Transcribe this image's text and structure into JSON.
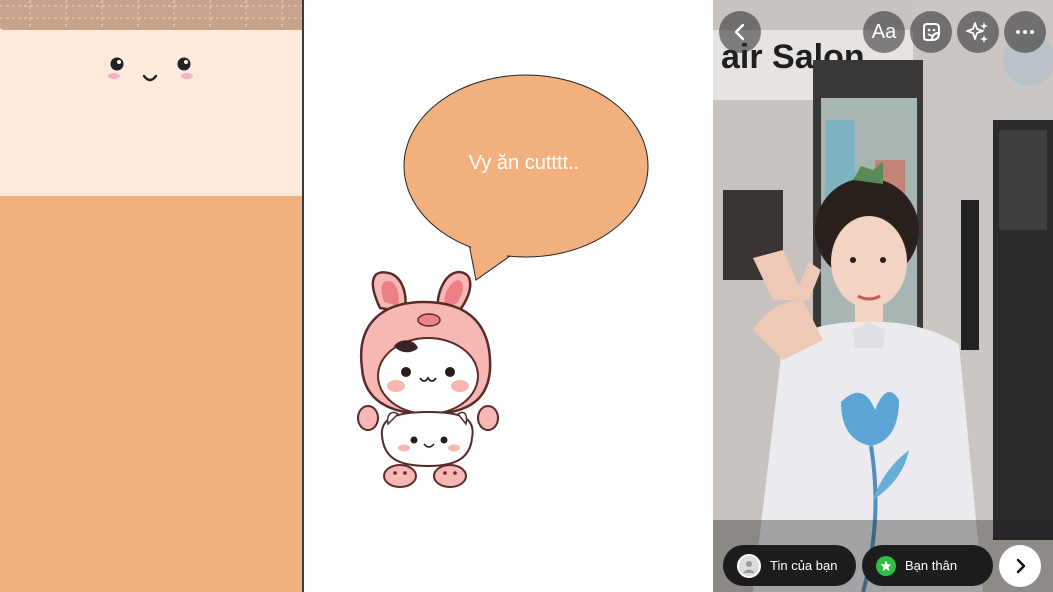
{
  "speech_bubble": {
    "text": "Vy ăn cutttt.."
  },
  "photo_sign": {
    "text": "air Salon"
  },
  "story_editor": {
    "text_tool_label": "Aa",
    "share_your_story_label": "Tin của bạn",
    "close_friends_label": "Bạn thân"
  },
  "colors": {
    "peach_background": "#f2b07f",
    "cream_background": "#fdeadb",
    "bubble_fill": "#f2b07f",
    "close_friends_green": "#2fbf47",
    "pill_background": "#1c1c1c"
  },
  "icons": {
    "back": "chevron-left-icon",
    "text": "text-aa-icon",
    "sticker": "sticker-icon",
    "effects": "sparkles-icon",
    "more": "more-horizontal-icon",
    "your_story": "story-avatar-icon",
    "close_friends": "green-star-icon",
    "next": "chevron-right-icon"
  }
}
